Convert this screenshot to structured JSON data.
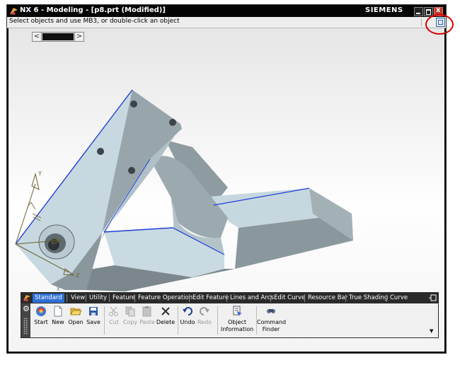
{
  "window": {
    "title": "NX 6 - Modeling - [p8.prt (Modified)]",
    "brand": "SIEMENS"
  },
  "cue": {
    "text": "Select objects and use MB3, or double-click an object"
  },
  "triad": {
    "x_label": "X",
    "y_label": "Y",
    "z_label": "Z"
  },
  "toolbar": {
    "tabs": [
      {
        "label": "Standard",
        "active": true
      },
      {
        "label": "View"
      },
      {
        "label": "Utility"
      },
      {
        "label": "Feature"
      },
      {
        "label": "Feature Operation"
      },
      {
        "label": "Edit Feature"
      },
      {
        "label": "Lines and Arcs"
      },
      {
        "label": "Edit Curve"
      },
      {
        "label": "Resource Bar"
      },
      {
        "label": "True Shading"
      },
      {
        "label": "Curve"
      }
    ],
    "tools": [
      {
        "label": "Start",
        "icon": "start-icon",
        "enabled": true
      },
      {
        "label": "New",
        "icon": "new-file-icon",
        "enabled": true
      },
      {
        "label": "Open",
        "icon": "open-folder-icon",
        "enabled": true
      },
      {
        "label": "Save",
        "icon": "save-disk-icon",
        "enabled": true
      },
      {
        "label": "Cut",
        "icon": "scissors-icon",
        "enabled": false
      },
      {
        "label": "Copy",
        "icon": "copy-icon",
        "enabled": false
      },
      {
        "label": "Paste",
        "icon": "paste-icon",
        "enabled": false
      },
      {
        "label": "Delete",
        "icon": "delete-x-icon",
        "enabled": true
      },
      {
        "label": "Undo",
        "icon": "undo-icon",
        "enabled": true
      },
      {
        "label": "Redo",
        "icon": "redo-icon",
        "enabled": false
      },
      {
        "label_line1": "Object",
        "label_line2": "Information",
        "icon": "object-information-icon",
        "enabled": true
      },
      {
        "label_line1": "Command",
        "label_line2": "Finder",
        "icon": "command-finder-icon",
        "enabled": true
      }
    ]
  },
  "colors": {
    "accent": "#2f6fd6",
    "part_face": "#c8d9e2",
    "part_shadow": "#7d8a90",
    "edge_highlight": "#1f3fd8",
    "annotation": "#d40000"
  }
}
